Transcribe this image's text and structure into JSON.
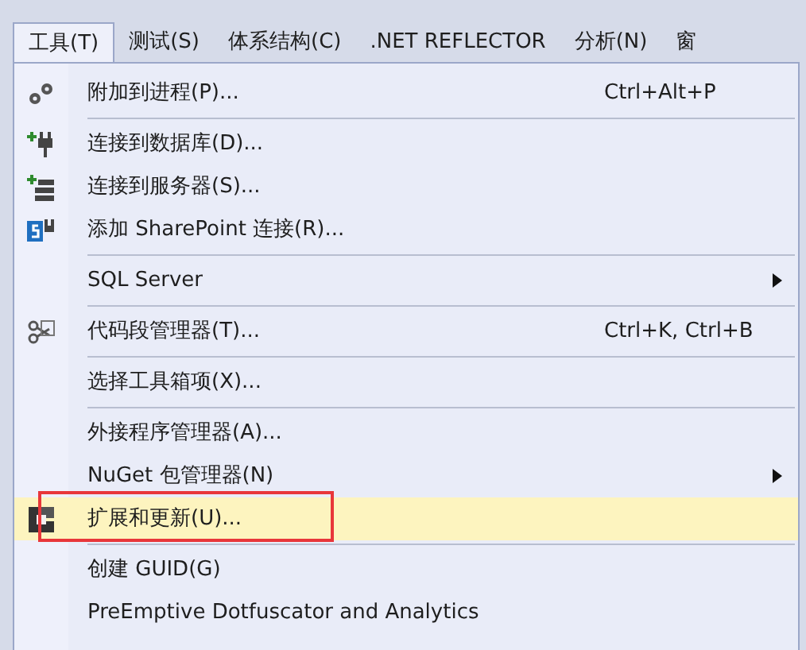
{
  "menu_bar": [
    {
      "label": "工具(T)",
      "selected": true
    },
    {
      "label": "测试(S)",
      "selected": false
    },
    {
      "label": "体系结构(C)",
      "selected": false
    },
    {
      "label": ".NET REFLECTOR",
      "selected": false
    },
    {
      "label": "分析(N)",
      "selected": false
    },
    {
      "label": "窗",
      "selected": false
    }
  ],
  "menu_groups": [
    [
      {
        "label": "附加到进程(P)...",
        "kind": "gears",
        "shortcut": "Ctrl+Alt+P",
        "submenu": false,
        "selected": false,
        "annotated": false
      }
    ],
    [
      {
        "label": "连接到数据库(D)...",
        "kind": "plug",
        "submenu": false,
        "selected": false,
        "annotated": false
      },
      {
        "label": "连接到服务器(S)...",
        "kind": "server",
        "submenu": false,
        "selected": false,
        "annotated": false
      },
      {
        "label": "添加 SharePoint 连接(R)...",
        "kind": "sharepoint",
        "submenu": false,
        "selected": false,
        "annotated": false
      }
    ],
    [
      {
        "label": "SQL Server",
        "submenu": true,
        "selected": false,
        "annotated": false
      }
    ],
    [
      {
        "label": "代码段管理器(T)...",
        "kind": "scissors",
        "shortcut": "Ctrl+K, Ctrl+B",
        "submenu": false,
        "selected": false,
        "annotated": false
      }
    ],
    [
      {
        "label": "选择工具箱项(X)...",
        "submenu": false,
        "selected": false,
        "annotated": false
      }
    ],
    [
      {
        "label": "外接程序管理器(A)...",
        "submenu": false,
        "selected": false,
        "annotated": false
      },
      {
        "label": "NuGet 包管理器(N)",
        "submenu": true,
        "selected": false,
        "annotated": false
      },
      {
        "label": "扩展和更新(U)...",
        "kind": "extension",
        "submenu": false,
        "selected": true,
        "annotated": true
      }
    ],
    [
      {
        "label": "创建 GUID(G)",
        "submenu": false,
        "selected": false,
        "annotated": false
      },
      {
        "label": "PreEmptive Dotfuscator and Analytics",
        "submenu": false,
        "selected": false,
        "annotated": false
      }
    ]
  ]
}
